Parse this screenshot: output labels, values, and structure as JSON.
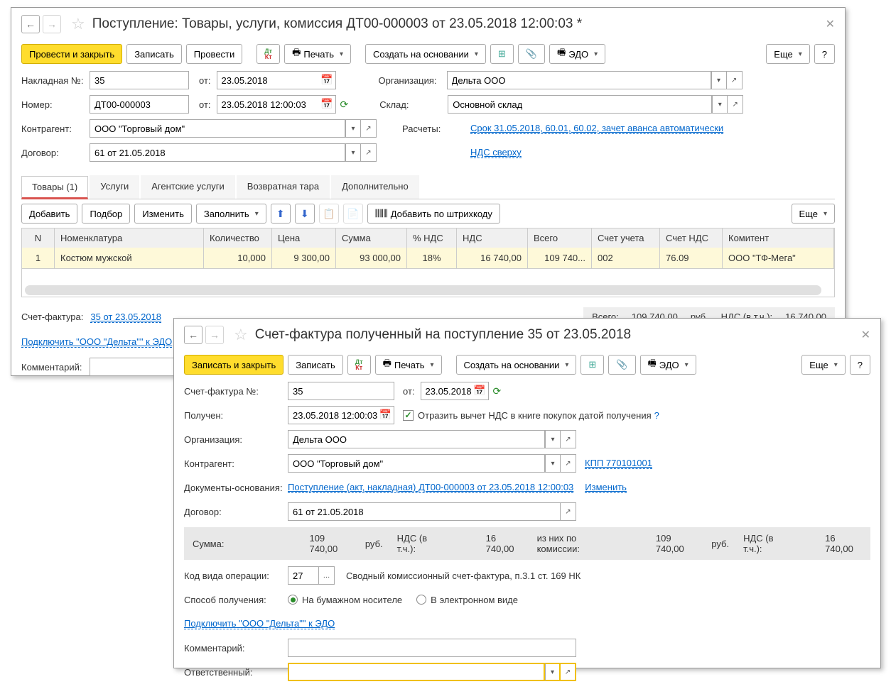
{
  "w1": {
    "title": "Поступление: Товары, услуги, комиссия ДТ00-000003 от 23.05.2018 12:00:03 *",
    "tb": {
      "post_close": "Провести и закрыть",
      "save": "Записать",
      "post": "Провести",
      "print": "Печать",
      "create_based": "Создать на основании",
      "edo": "ЭДО",
      "more": "Еще"
    },
    "f": {
      "invoice_lbl": "Накладная №:",
      "invoice_no": "35",
      "from": "от:",
      "invoice_date": "23.05.2018",
      "org_lbl": "Организация:",
      "org": "Дельта ООО",
      "num_lbl": "Номер:",
      "num": "ДТ00-000003",
      "num_date": "23.05.2018 12:00:03",
      "warehouse_lbl": "Склад:",
      "warehouse": "Основной склад",
      "counter_lbl": "Контрагент:",
      "counter": "ООО \"Торговый дом\"",
      "settle_lbl": "Расчеты:",
      "settle_link": "Срок 31.05.2018, 60.01, 60.02, зачет аванса автоматически",
      "contract_lbl": "Договор:",
      "contract": "61 от 21.05.2018",
      "vat_link": "НДС сверху"
    },
    "tabs": [
      "Товары (1)",
      "Услуги",
      "Агентские услуги",
      "Возвратная тара",
      "Дополнительно"
    ],
    "sub": {
      "add": "Добавить",
      "pick": "Подбор",
      "edit": "Изменить",
      "fill": "Заполнить",
      "barcode": "Добавить по штрихкоду",
      "more": "Еще"
    },
    "cols": [
      "N",
      "Номенклатура",
      "Количество",
      "Цена",
      "Сумма",
      "% НДС",
      "НДС",
      "Всего",
      "Счет учета",
      "Счет НДС",
      "Комитент"
    ],
    "row": [
      "1",
      "Костюм мужской",
      "10,000",
      "9 300,00",
      "93 000,00",
      "18%",
      "16 740,00",
      "109 740...",
      "002",
      "76.09",
      "ООО \"ТФ-Мега\""
    ],
    "foot": {
      "sf_lbl": "Счет-фактура:",
      "sf_link": "35 от 23.05.2018",
      "total_lbl": "Всего:",
      "total": "109 740,00",
      "cur": "руб.",
      "vat_lbl": "НДС (в т.ч.):",
      "vat": "16 740,00",
      "connect": "Подключить \"ООО \"Дельта\"\" к ЭДО",
      "comment_lbl": "Комментарий:"
    }
  },
  "w2": {
    "title": "Счет-фактура полученный на поступление 35 от 23.05.2018",
    "tb": {
      "save_close": "Записать и закрыть",
      "save": "Записать",
      "print": "Печать",
      "create_based": "Создать на основании",
      "edo": "ЭДО",
      "more": "Еще"
    },
    "f": {
      "sf_lbl": "Счет-фактура №:",
      "sf_no": "35",
      "from": "от:",
      "sf_date": "23.05.2018",
      "recv_lbl": "Получен:",
      "recv_date": "23.05.2018 12:00:03",
      "reflect": "Отразить вычет НДС в книге покупок датой получения",
      "org_lbl": "Организация:",
      "org": "Дельта ООО",
      "counter_lbl": "Контрагент:",
      "counter": "ООО \"Торговый дом\"",
      "kpp": "КПП 770101001",
      "docs_lbl": "Документы-основания:",
      "docs_link": "Поступление (акт, накладная) ДТ00-000003 от 23.05.2018 12:00:03",
      "edit_link": "Изменить",
      "contract_lbl": "Договор:",
      "contract": "61 от 21.05.2018",
      "sum_lbl": "Сумма:",
      "sum": "109 740,00",
      "cur": "руб.",
      "vat_lbl": "НДС (в т.ч.):",
      "vat": "16 740,00",
      "comm_lbl": "из них по комиссии:",
      "comm_sum": "109 740,00",
      "comm_vat": "16 740,00",
      "opcode_lbl": "Код вида операции:",
      "opcode": "27",
      "opcode_desc": "Сводный комиссионный счет-фактура, п.3.1 ст. 169 НК",
      "method_lbl": "Способ получения:",
      "method_paper": "На бумажном носителе",
      "method_elec": "В электронном виде",
      "connect": "Подключить \"ООО \"Дельта\"\" к ЭДО",
      "comment_lbl": "Комментарий:",
      "resp_lbl": "Ответственный:"
    }
  }
}
